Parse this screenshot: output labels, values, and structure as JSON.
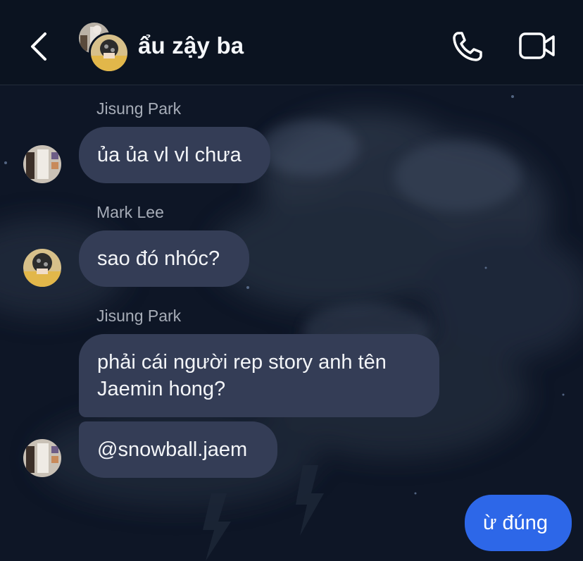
{
  "header": {
    "title": "ẩu zậy ba",
    "back_icon": "chevron-left-icon",
    "call_icon": "phone-icon",
    "video_icon": "video-camera-icon"
  },
  "messages": [
    {
      "sender": "Jisung Park",
      "text": "ủa ủa vl vl chưa",
      "outgoing": false
    },
    {
      "sender": "Mark Lee",
      "text": "sao đó nhóc?",
      "outgoing": false
    },
    {
      "sender": "Jisung Park",
      "lines": [
        "phải cái người rep story anh tên",
        "Jaemin hong?"
      ],
      "outgoing": false
    },
    {
      "text": "@snowball.jaem",
      "outgoing": false
    },
    {
      "text": "ừ đúng",
      "outgoing": true
    }
  ],
  "colors": {
    "background": "#0d1524",
    "incoming_bubble": "#343d56",
    "outgoing_bubble": "#2d67e8",
    "sender_text": "#a7adb8"
  }
}
